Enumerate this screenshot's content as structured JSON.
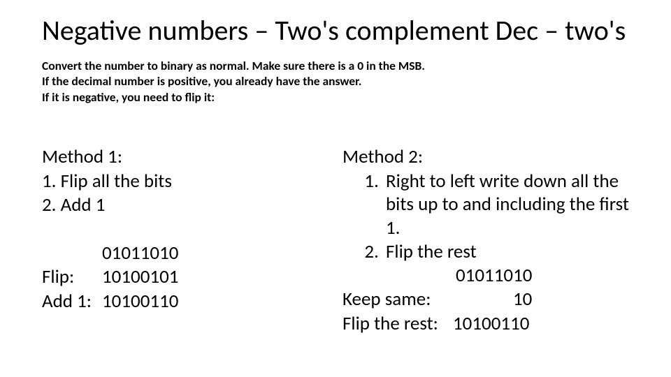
{
  "title": "Negative numbers – Two's complement Dec – two's",
  "intro_line1": "Convert the number to binary as normal.  Make sure there is a 0 in the MSB.",
  "intro_line2": "If the decimal number is positive, you already have the answer.",
  "intro_line3": "If it is negative, you need to flip it:",
  "method1": {
    "heading": "Method 1:",
    "step1": "1. Flip all the bits",
    "step2": "2. Add 1",
    "bits_original": "01011010",
    "flip_label": "Flip:",
    "flip_value": "10100101",
    "add_label": "Add 1:",
    "add_value": "10100110"
  },
  "method2": {
    "heading": "Method 2:",
    "step1": "Right to left write down all the bits up to and including the first 1.",
    "step2": "Flip the rest",
    "bits_original": "01011010",
    "keep_label": "Keep same:",
    "keep_value": "10",
    "flip_label": "Flip the rest:",
    "flip_value": "10100110"
  }
}
